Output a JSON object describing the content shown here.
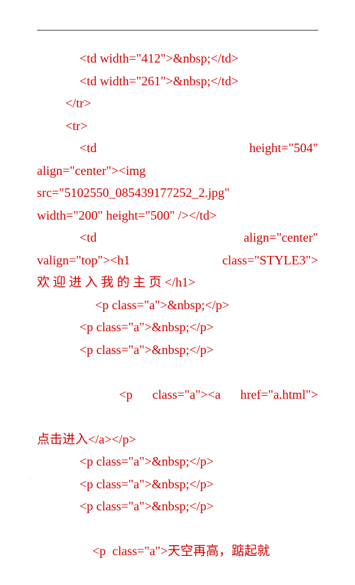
{
  "lines": {
    "l01a": "<td width=\"412\">&nbsp;</td>",
    "l01b": "<td width=\"261\">&nbsp;</td>",
    "l02": "</tr>",
    "l03": "<tr>",
    "l04a": "<td",
    "l04b": "height=\"504\"",
    "l05": "align=\"center\"><img",
    "l06": "src=\"5102550_085439177252_2.jpg\"",
    "l07": "width=\"200\" height=\"500\" /></td>",
    "l08a": "<td",
    "l08b": "align=\"center\"",
    "l09a": "valign=\"top\"><h1",
    "l09b": "class=\"STYLE3\">",
    "l10": "欢 迎 进 入 我 的 主 页 </h1>",
    "l11": "<p class=\"a\">&nbsp;</p>",
    "l12": "<p class=\"a\">&nbsp;</p>",
    "l13": "<p class=\"a\">&nbsp;</p>",
    "l14a": "<p",
    "l14b": "class=\"a\"><a",
    "l14c": "href=\"a.html\">",
    "l15": "点击进入</a></p>",
    "l16": "<p class=\"a\">&nbsp;</p>",
    "l17": "<p class=\"a\">&nbsp;</p>",
    "l18": "<p class=\"a\">&nbsp;</p>",
    "l19a": "<p",
    "l19b": "class=\"a\">天空再高，踮起就"
  },
  "bottom_mark": "."
}
